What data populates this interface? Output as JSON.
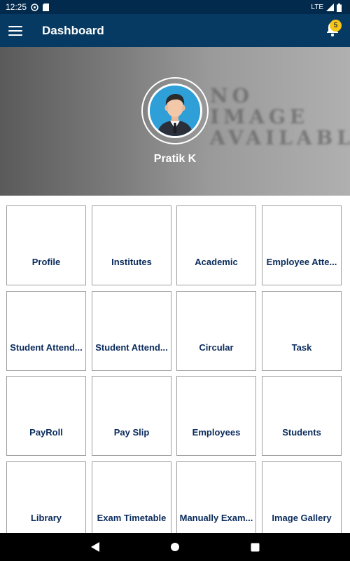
{
  "status_bar": {
    "time": "12:25",
    "network": "LTE"
  },
  "app_bar": {
    "title": "Dashboard",
    "notification_count": "5"
  },
  "banner": {
    "watermark_lines": [
      "NO",
      "IMAGE",
      "AVAILABLE"
    ],
    "user_name": "Pratik K"
  },
  "tiles": [
    {
      "label": "Profile"
    },
    {
      "label": "Institutes"
    },
    {
      "label": "Academic"
    },
    {
      "label": "Employee Atte..."
    },
    {
      "label": "Student Attend..."
    },
    {
      "label": "Student Attend..."
    },
    {
      "label": "Circular"
    },
    {
      "label": "Task"
    },
    {
      "label": "PayRoll"
    },
    {
      "label": "Pay Slip"
    },
    {
      "label": "Employees"
    },
    {
      "label": "Students"
    },
    {
      "label": "Library"
    },
    {
      "label": "Exam Timetable"
    },
    {
      "label": "Manually Exam..."
    },
    {
      "label": "Image Gallery"
    }
  ],
  "colors": {
    "status_bar": "#022a4d",
    "app_bar": "#063a63",
    "tile_text": "#0a2b5c",
    "badge": "#f5c518",
    "avatar_bg": "#2f9fd8"
  }
}
